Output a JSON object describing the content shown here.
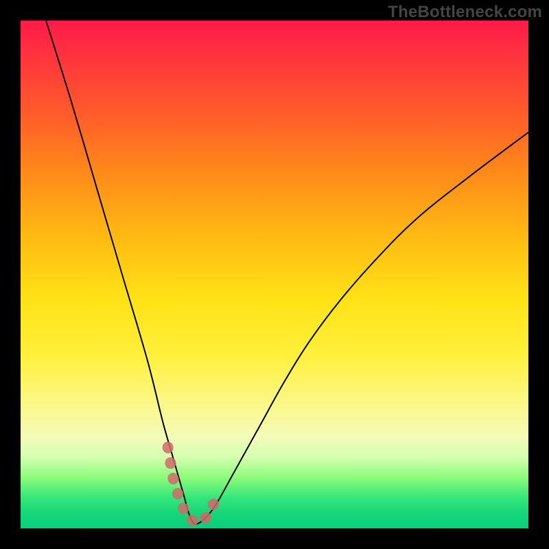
{
  "watermark": {
    "text": "TheBottleneck.com"
  },
  "chart_data": {
    "type": "line",
    "title": "",
    "xlabel": "",
    "ylabel": "",
    "xlim": [
      0,
      100
    ],
    "ylim": [
      0,
      100
    ],
    "grid": false,
    "series": [
      {
        "name": "bottleneck-curve",
        "color": "#000000",
        "x": [
          5,
          10,
          15,
          20,
          25,
          28,
          30,
          32,
          33.5,
          35,
          38,
          42,
          47,
          52,
          57,
          63,
          70,
          78,
          88,
          100
        ],
        "y": [
          100,
          84,
          67,
          50,
          33,
          21,
          14,
          7,
          2,
          1,
          4,
          11,
          20,
          29,
          37,
          45,
          53,
          61,
          69,
          78
        ]
      }
    ],
    "highlight": {
      "name": "optimal-range-marker",
      "color": "#d06a6a",
      "x": [
        29,
        30,
        31.5,
        33,
        35,
        37,
        38.5
      ],
      "y": [
        16,
        10,
        5,
        2,
        1,
        2.5,
        6
      ]
    },
    "colors": {
      "gradient_top": "#ff1a49",
      "gradient_mid": "#ffe216",
      "gradient_bottom": "#07cf7b",
      "curve": "#000000",
      "marker": "#d06a6a",
      "frame": "#000000"
    }
  }
}
